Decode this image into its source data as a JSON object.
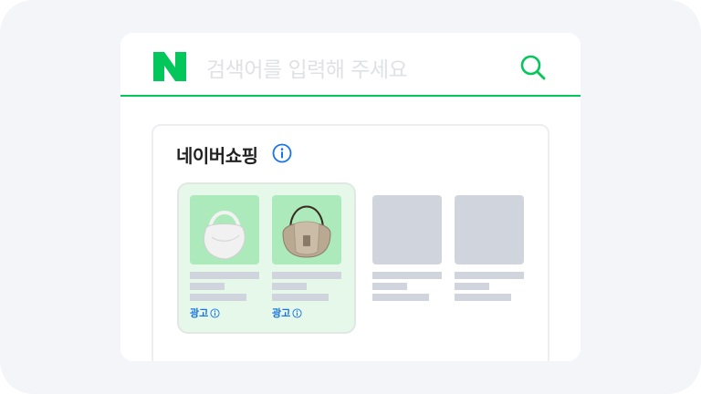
{
  "search": {
    "logo": "N",
    "placeholder": "검색어를 입력해 주세요",
    "search_icon": "search-icon",
    "accent": "#03c75a"
  },
  "shopping": {
    "title": "네이버쇼핑",
    "info_icon": "info-icon",
    "products": [
      {
        "type": "ad",
        "image": "white-hobo-bag",
        "ad_label": "광고"
      },
      {
        "type": "ad",
        "image": "beige-saddle-bag",
        "ad_label": "광고"
      },
      {
        "type": "placeholder"
      },
      {
        "type": "placeholder"
      }
    ]
  }
}
